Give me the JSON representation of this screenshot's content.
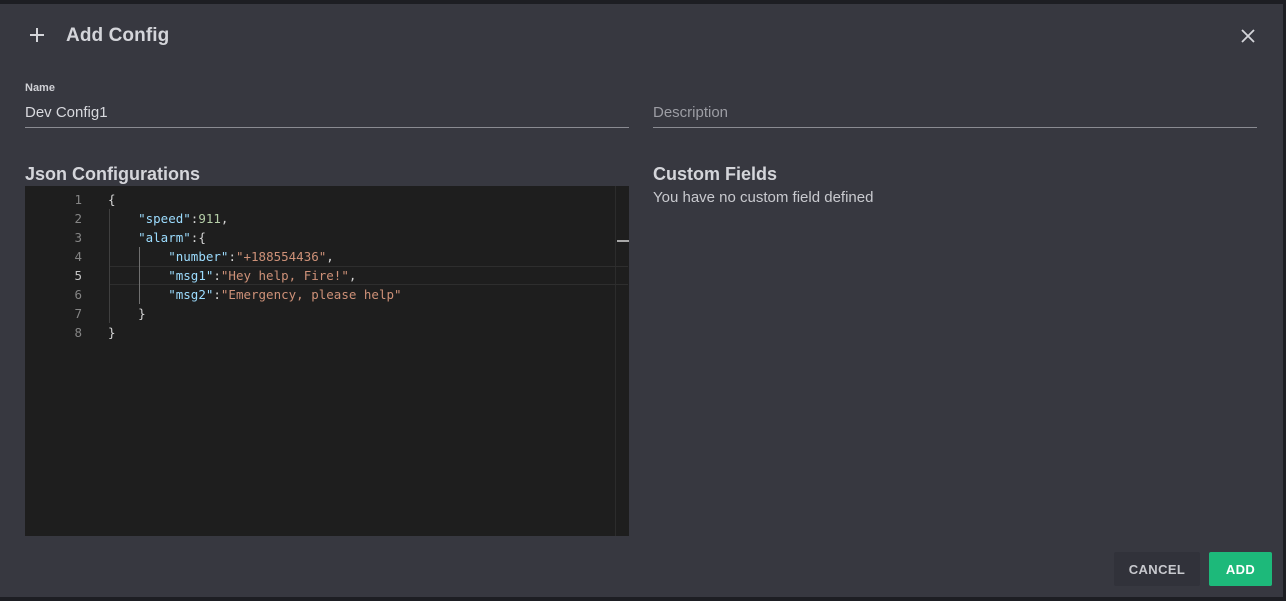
{
  "dialog": {
    "title": "Add Config",
    "close_icon": "close-icon",
    "add_icon": "plus-icon"
  },
  "form": {
    "name": {
      "label": "Name",
      "value": "Dev Config1"
    },
    "description": {
      "placeholder": "Description",
      "value": ""
    }
  },
  "json_section": {
    "title": "Json Configurations",
    "active_line": 5,
    "lines": [
      {
        "number": "1",
        "text": "{"
      },
      {
        "number": "2",
        "text": "    \"speed\":911,"
      },
      {
        "number": "3",
        "text": "    \"alarm\":{"
      },
      {
        "number": "4",
        "text": "        \"number\":\"+188554436\","
      },
      {
        "number": "5",
        "text": "        \"msg1\":\"Hey help, Fire!\","
      },
      {
        "number": "6",
        "text": "        \"msg2\":\"Emergency, please help\""
      },
      {
        "number": "7",
        "text": "    }"
      },
      {
        "number": "8",
        "text": "}"
      }
    ]
  },
  "custom_fields": {
    "title": "Custom Fields",
    "empty_text": "You have no custom field defined"
  },
  "actions": {
    "cancel_label": "CANCEL",
    "add_label": "ADD"
  },
  "colors": {
    "dialog_bg": "#373840",
    "editor_bg": "#1e1e1e",
    "primary": "#1db97a",
    "json_key": "#9cdcfe",
    "json_string": "#ce9178",
    "json_number": "#b5cea8"
  }
}
